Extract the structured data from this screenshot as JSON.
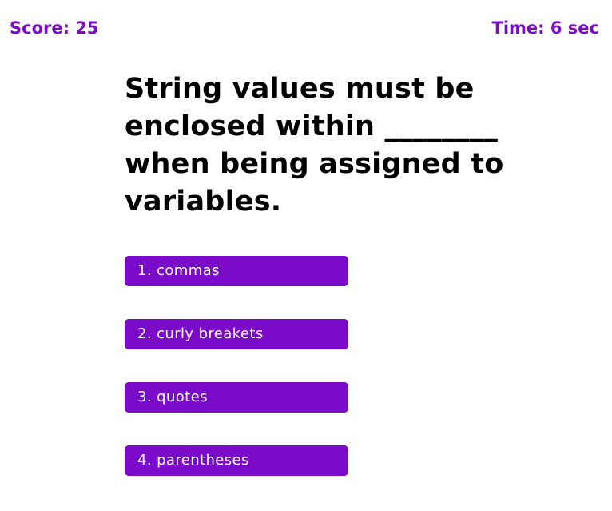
{
  "header": {
    "score_text": "Score: 25",
    "time_text": "Time: 6 sec"
  },
  "question": {
    "text": "String values must be enclosed within ________ when being assigned to variables."
  },
  "choices": [
    {
      "label": "1. commas"
    },
    {
      "label": "2. curly breakets"
    },
    {
      "label": "3. quotes"
    },
    {
      "label": "4. parentheses"
    }
  ],
  "colors": {
    "accent": "#7a0bc8",
    "button_text": "#ffffff",
    "question_text": "#000000",
    "background": "#ffffff"
  }
}
